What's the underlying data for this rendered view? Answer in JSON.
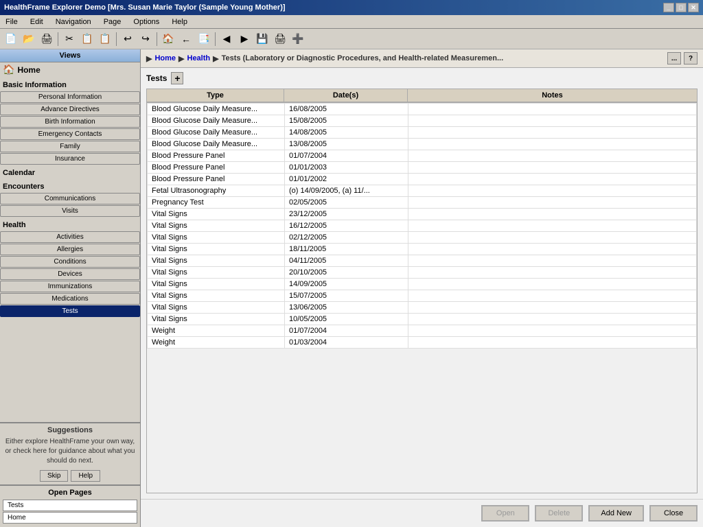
{
  "titlebar": {
    "title": "HealthFrame Explorer Demo [Mrs. Susan Marie Taylor (Sample Young Mother)]",
    "controls": [
      "_",
      "□",
      "✕"
    ]
  },
  "menubar": {
    "items": [
      "File",
      "Edit",
      "Navigation",
      "Page",
      "Options",
      "Help"
    ]
  },
  "toolbar": {
    "buttons": [
      "🏠",
      "←",
      "→",
      "📄",
      "✂",
      "📋",
      "📋",
      "↩",
      "↪",
      "🏠",
      "←",
      "📄",
      "◀",
      "▶",
      "💾",
      "🖨",
      "➕"
    ]
  },
  "sidebar": {
    "home_label": "Home",
    "views_label": "Views",
    "sections": {
      "basic_information": {
        "label": "Basic Information",
        "items": [
          "Personal Information",
          "Advance Directives",
          "Birth Information",
          "Emergency Contacts",
          "Family",
          "Insurance"
        ]
      },
      "calendar": {
        "label": "Calendar"
      },
      "encounters": {
        "label": "Encounters",
        "items": [
          "Communications",
          "Visits"
        ]
      },
      "health": {
        "label": "Health",
        "items": [
          "Activities",
          "Allergies",
          "Conditions",
          "Devices",
          "Immunizations",
          "Medications",
          "Tests"
        ]
      }
    }
  },
  "suggestions": {
    "header": "Suggestions",
    "text": "Either explore HealthFrame your own way, or check here for guidance about what you should do next.",
    "skip_label": "Skip",
    "help_label": "Help"
  },
  "open_pages": {
    "header": "Open Pages",
    "items": [
      "Tests",
      "Home"
    ]
  },
  "breadcrumb": {
    "items": [
      "Home",
      "Health",
      "Tests (Laboratory or Diagnostic Procedures, and Health-related Measuremen..."
    ],
    "arrows": [
      "▶",
      "▶"
    ],
    "controls": [
      "...",
      "?"
    ]
  },
  "tests_section": {
    "label": "Tests",
    "add_tooltip": "Add"
  },
  "table": {
    "headers": [
      "Type",
      "Date(s)",
      "Notes"
    ],
    "rows": [
      {
        "type": "Blood Glucose Daily Measure...",
        "dates": "16/08/2005",
        "notes": ""
      },
      {
        "type": "Blood Glucose Daily Measure...",
        "dates": "15/08/2005",
        "notes": ""
      },
      {
        "type": "Blood Glucose Daily Measure...",
        "dates": "14/08/2005",
        "notes": ""
      },
      {
        "type": "Blood Glucose Daily Measure...",
        "dates": "13/08/2005",
        "notes": ""
      },
      {
        "type": "Blood Pressure Panel",
        "dates": "01/07/2004",
        "notes": ""
      },
      {
        "type": "Blood Pressure Panel",
        "dates": "01/01/2003",
        "notes": ""
      },
      {
        "type": "Blood Pressure Panel",
        "dates": "01/01/2002",
        "notes": ""
      },
      {
        "type": "Fetal Ultrasonography",
        "dates": "(o) 14/09/2005, (a) 11/...",
        "notes": ""
      },
      {
        "type": "Pregnancy Test",
        "dates": "02/05/2005",
        "notes": ""
      },
      {
        "type": "Vital Signs",
        "dates": "23/12/2005",
        "notes": ""
      },
      {
        "type": "Vital Signs",
        "dates": "16/12/2005",
        "notes": ""
      },
      {
        "type": "Vital Signs",
        "dates": "02/12/2005",
        "notes": ""
      },
      {
        "type": "Vital Signs",
        "dates": "18/11/2005",
        "notes": ""
      },
      {
        "type": "Vital Signs",
        "dates": "04/11/2005",
        "notes": ""
      },
      {
        "type": "Vital Signs",
        "dates": "20/10/2005",
        "notes": ""
      },
      {
        "type": "Vital Signs",
        "dates": "14/09/2005",
        "notes": ""
      },
      {
        "type": "Vital Signs",
        "dates": "15/07/2005",
        "notes": ""
      },
      {
        "type": "Vital Signs",
        "dates": "13/06/2005",
        "notes": ""
      },
      {
        "type": "Vital Signs",
        "dates": "10/05/2005",
        "notes": ""
      },
      {
        "type": "Weight",
        "dates": "01/07/2004",
        "notes": ""
      },
      {
        "type": "Weight",
        "dates": "01/03/2004",
        "notes": ""
      }
    ]
  },
  "buttons": {
    "open": "Open",
    "delete": "Delete",
    "add_new": "Add New",
    "close": "Close"
  }
}
